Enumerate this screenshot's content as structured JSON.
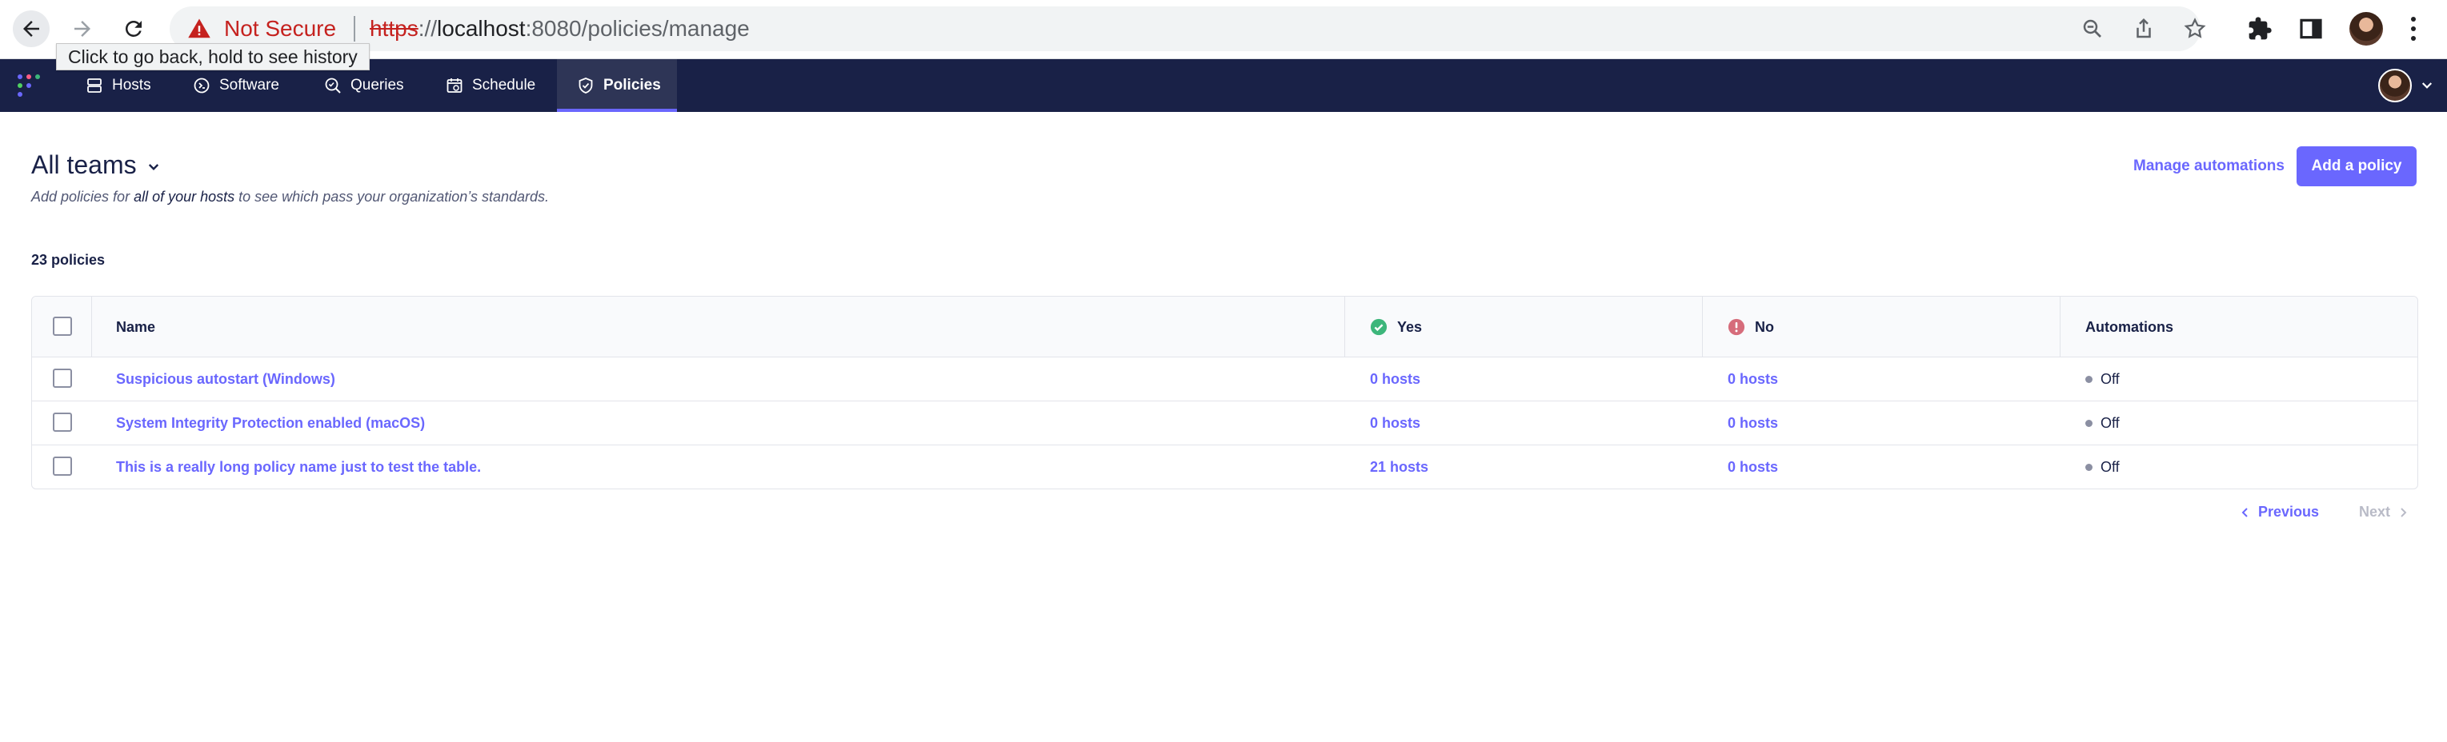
{
  "browser": {
    "tooltip": "Click to go back, hold to see history",
    "security_label": "Not Secure",
    "url_scheme": "https",
    "url_sep": "://",
    "url_host": "localhost",
    "url_rest": ":8080/policies/manage"
  },
  "nav": {
    "items": [
      {
        "label": "Hosts",
        "icon": "hosts-icon"
      },
      {
        "label": "Software",
        "icon": "software-icon"
      },
      {
        "label": "Queries",
        "icon": "queries-icon"
      },
      {
        "label": "Schedule",
        "icon": "schedule-icon"
      },
      {
        "label": "Policies",
        "icon": "policies-icon",
        "active": true
      }
    ],
    "accent": "#6a67fe",
    "background": "#192147"
  },
  "page": {
    "team": "All teams",
    "subtitle_pre": "Add policies for ",
    "subtitle_emph": "all of your hosts",
    "subtitle_post": " to see which pass your organization’s standards.",
    "manage_automations": "Manage automations",
    "add_policy": "Add a policy",
    "count": "23 policies"
  },
  "table": {
    "headers": {
      "name": "Name",
      "yes": "Yes",
      "no": "No",
      "automations": "Automations"
    },
    "rows": [
      {
        "name": "Suspicious autostart (Windows)",
        "yes": "0 hosts",
        "no": "0 hosts",
        "automations": "Off"
      },
      {
        "name": "System Integrity Protection enabled (macOS)",
        "yes": "0 hosts",
        "no": "0 hosts",
        "automations": "Off"
      },
      {
        "name": "This is a really long policy name just to test the table.",
        "yes": "21 hosts",
        "no": "0 hosts",
        "automations": "Off"
      }
    ]
  },
  "pagination": {
    "previous": "Previous",
    "next": "Next"
  }
}
